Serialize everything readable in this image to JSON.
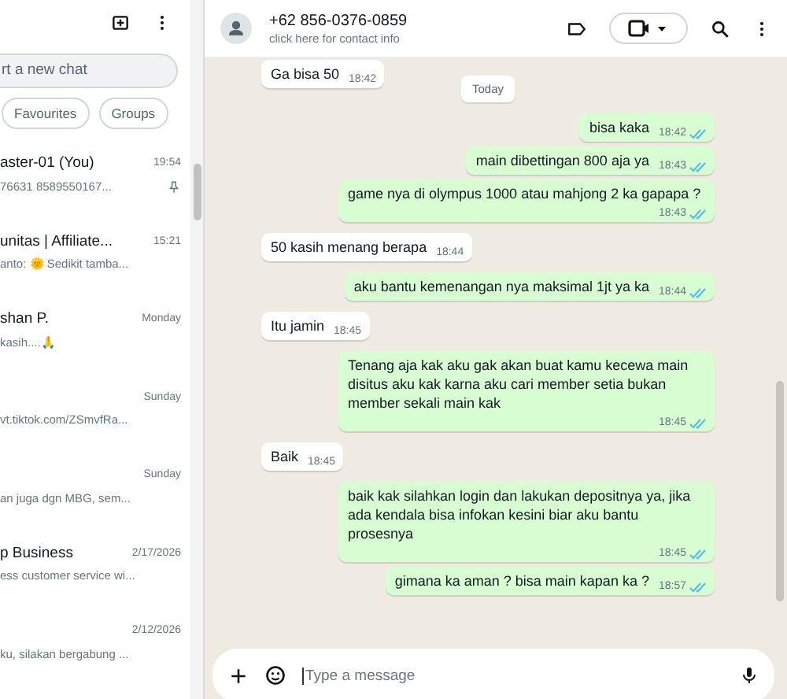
{
  "sidebar": {
    "search": {
      "placeholder": "rt a new chat"
    },
    "filters": [
      {
        "label": "Favourites",
        "selected": false
      },
      {
        "label": "Groups",
        "selected": false
      }
    ],
    "chats": [
      {
        "name": "aster-01 (You)",
        "time": "19:54",
        "preview": "76631 8589550167...",
        "pinned": true
      },
      {
        "name": "unitas | Affiliate...",
        "time": "15:21",
        "preview": "anto: 🌞 Sedikit tamba...",
        "pinned": false
      },
      {
        "name": "shan P.",
        "time": "Monday",
        "preview": "kasih....🙏",
        "pinned": false
      },
      {
        "time": "Sunday",
        "preview": "vt.tiktok.com/ZSmvfRa...",
        "pinned": false
      },
      {
        "time": "Sunday",
        "preview": "an juga dgn MBG, sem...",
        "pinned": false
      },
      {
        "name": "p Business",
        "time": "2/17/2026",
        "preview": "ess customer service wi...",
        "pinned": false
      },
      {
        "time": "2/12/2026",
        "preview": "ku, silakan bergabung ...",
        "pinned": false
      }
    ]
  },
  "chat": {
    "title": "+62 856-0376-0859",
    "subtitle": "click here for contact info",
    "messages": [
      {
        "kind": "incoming",
        "text": "Ga bisa 50",
        "time": "18:42"
      },
      {
        "kind": "date",
        "text": "Today"
      },
      {
        "kind": "outgoing",
        "text": "bisa kaka",
        "time": "18:42",
        "read": true
      },
      {
        "kind": "outgoing",
        "text": "main dibettingan 800 aja ya",
        "time": "18:43",
        "read": true
      },
      {
        "kind": "outgoing",
        "text": "game nya di olympus 1000 atau mahjong 2 ka gapapa ?",
        "time": "18:43",
        "read": true
      },
      {
        "kind": "incoming",
        "text": "50 kasih menang berapa",
        "time": "18:44"
      },
      {
        "kind": "outgoing",
        "text": "aku bantu kemenangan nya maksimal 1jt ya ka",
        "time": "18:44",
        "read": true
      },
      {
        "kind": "incoming",
        "text": "Itu jamin",
        "time": "18:45"
      },
      {
        "kind": "outgoing",
        "text": "Tenang aja kak aku gak akan buat kamu kecewa main disitus aku kak karna aku cari member setia bukan member sekali main kak",
        "time": "18:45",
        "read": true
      },
      {
        "kind": "incoming",
        "text": "Baik",
        "time": "18:45"
      },
      {
        "kind": "outgoing",
        "text": "baik kak silahkan login dan lakukan depositnya ya, jika ada kendala bisa infokan kesini biar aku bantu prosesnya",
        "time": "18:45",
        "read": true
      },
      {
        "kind": "outgoing",
        "text": "gimana ka aman ? bisa main kapan ka ?",
        "time": "18:57",
        "read": true
      }
    ],
    "composer": {
      "placeholder": "Type a message"
    }
  }
}
